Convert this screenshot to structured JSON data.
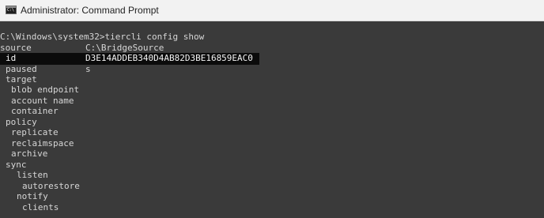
{
  "window": {
    "title": "Administrator: Command Prompt",
    "icon": "command-prompt-icon"
  },
  "console": {
    "prompt": "C:\\Windows\\system32>tiercli config show",
    "rows": [
      {
        "key": "source",
        "value": "C:\\BridgeSource"
      },
      {
        "key": "id",
        "value": "D3E14ADDEB340D4AB82D3BE16859EAC0"
      },
      {
        "key": "paused",
        "value": "s"
      },
      {
        "key": "target",
        "value": ""
      },
      {
        "key": "blob endpoint",
        "value": ""
      },
      {
        "key": "account name",
        "value": ""
      },
      {
        "key": "container",
        "value": ""
      },
      {
        "key": "policy",
        "value": ""
      },
      {
        "key": "replicate",
        "value": ""
      },
      {
        "key": "reclaimspace",
        "value": ""
      },
      {
        "key": "archive",
        "value": ""
      },
      {
        "key": "sync",
        "value": ""
      },
      {
        "key": "listen",
        "value": ""
      },
      {
        "key": "autorestore",
        "value": ""
      },
      {
        "key": "notify",
        "value": ""
      },
      {
        "key": "clients",
        "value": ""
      }
    ]
  },
  "colors": {
    "console_background": "#3a3a3a",
    "console_text": "#d6d6d6",
    "selection_background": "#0b0b0b",
    "titlebar_background": "#f2f2f2"
  }
}
